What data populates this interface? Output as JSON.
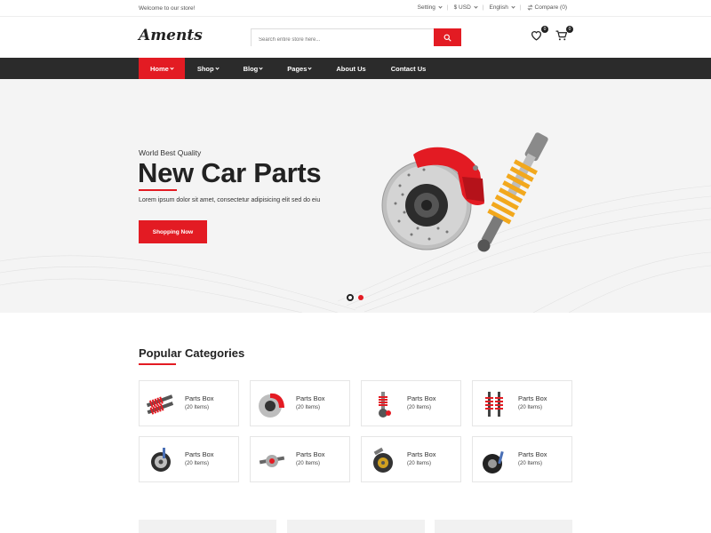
{
  "topbar": {
    "welcome": "Welcome to our store!",
    "setting": "Setting",
    "currency": "$ USD",
    "language": "English",
    "compare": "Compare (0)",
    "separator": "|"
  },
  "header": {
    "logo": "Aments",
    "search_placeholder": "Search entire store here...",
    "wishlist_count": "0",
    "cart_count": "0"
  },
  "nav": {
    "items": [
      {
        "label": "Home"
      },
      {
        "label": "Shop"
      },
      {
        "label": "Blog"
      },
      {
        "label": "Pages"
      },
      {
        "label": "About Us"
      },
      {
        "label": "Contact Us"
      }
    ]
  },
  "hero": {
    "tagline": "World Best Quality",
    "title": "New Car Parts",
    "description": "Lorem ipsum dolor sit amet, consectetur adipisicing elit sed do eiu",
    "button": "Shopping Now"
  },
  "categories": {
    "title": "Popular Categories",
    "items": [
      {
        "name": "Parts Box",
        "count": "(20 Items)",
        "icon": "shock-absorbers-icon"
      },
      {
        "name": "Parts Box",
        "count": "(20 Items)",
        "icon": "brake-disc-icon"
      },
      {
        "name": "Parts Box",
        "count": "(20 Items)",
        "icon": "suspension-icon"
      },
      {
        "name": "Parts Box",
        "count": "(20 Items)",
        "icon": "coilover-icon"
      },
      {
        "name": "Parts Box",
        "count": "(20 Items)",
        "icon": "wheel-hub-icon"
      },
      {
        "name": "Parts Box",
        "count": "(20 Items)",
        "icon": "axle-icon"
      },
      {
        "name": "Parts Box",
        "count": "(20 Items)",
        "icon": "wheel-assembly-icon"
      },
      {
        "name": "Parts Box",
        "count": "(20 Items)",
        "icon": "tire-icon"
      }
    ]
  },
  "colors": {
    "accent": "#e31b23",
    "nav_bg": "#2b2b2b",
    "hero_bg": "#f4f4f4"
  }
}
